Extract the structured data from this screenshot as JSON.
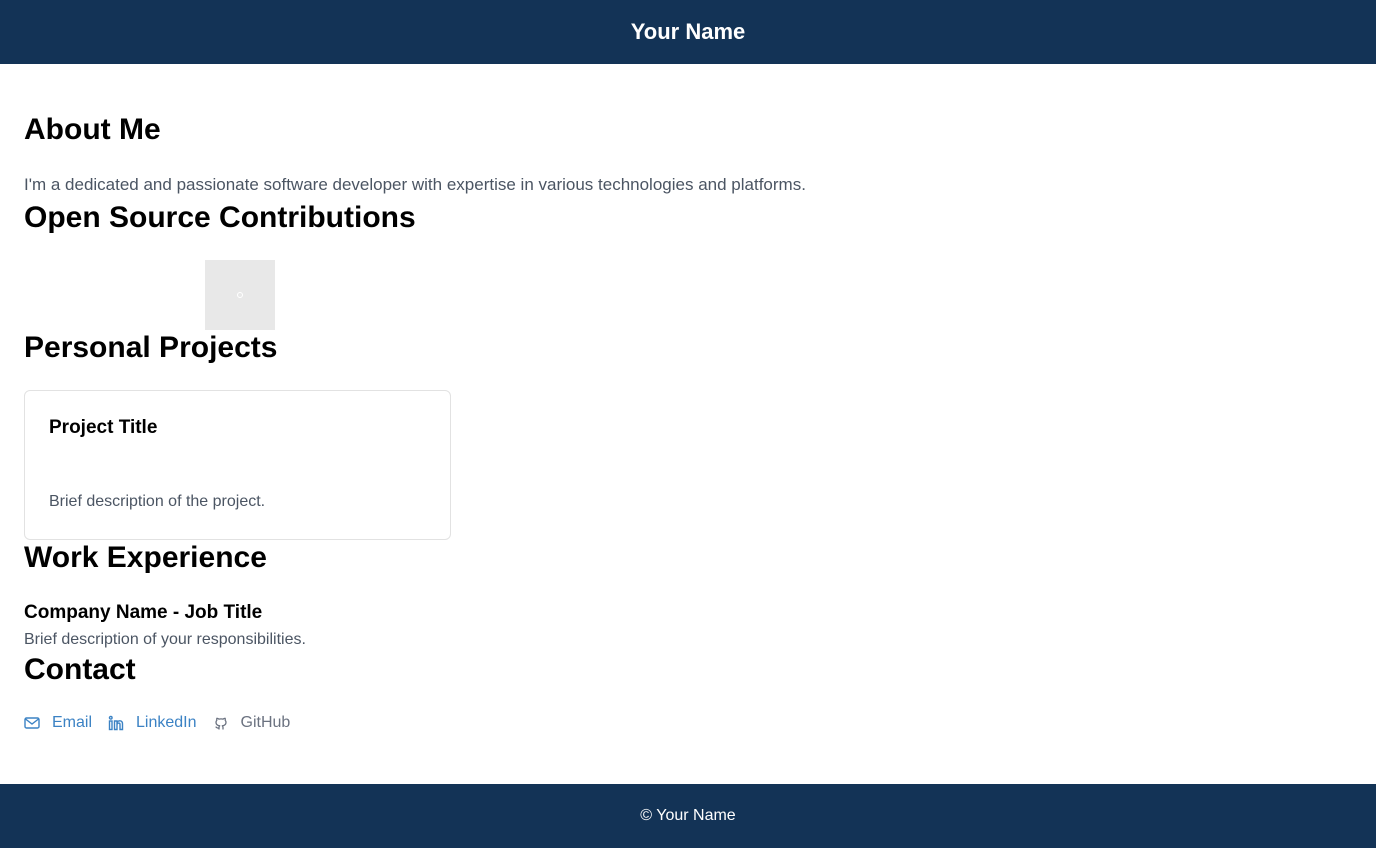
{
  "header": {
    "title": "Your Name"
  },
  "about": {
    "heading": "About Me",
    "text": "I'm a dedicated and passionate software developer with expertise in various technologies and platforms."
  },
  "open_source": {
    "heading": "Open Source Contributions",
    "image_icon": "image-placeholder-icon"
  },
  "projects": {
    "heading": "Personal Projects",
    "items": [
      {
        "title": "Project Title",
        "description": "Brief description of the project."
      }
    ]
  },
  "work": {
    "heading": "Work Experience",
    "items": [
      {
        "title": "Company Name - Job Title",
        "description": "Brief description of your responsibilities."
      }
    ]
  },
  "contact": {
    "heading": "Contact",
    "links": [
      {
        "label": "Email",
        "icon": "mail-icon",
        "color": "#3b82c4"
      },
      {
        "label": "LinkedIn",
        "icon": "linkedin-icon",
        "color": "#3b82c4"
      },
      {
        "label": "GitHub",
        "icon": "github-icon",
        "color": "#6b7280"
      }
    ]
  },
  "footer": {
    "text": "© Your Name"
  },
  "colors": {
    "header_bg": "#133356",
    "footer_bg": "#133356",
    "body_text_muted": "#4b5563",
    "link_blue": "#3b82c4"
  }
}
